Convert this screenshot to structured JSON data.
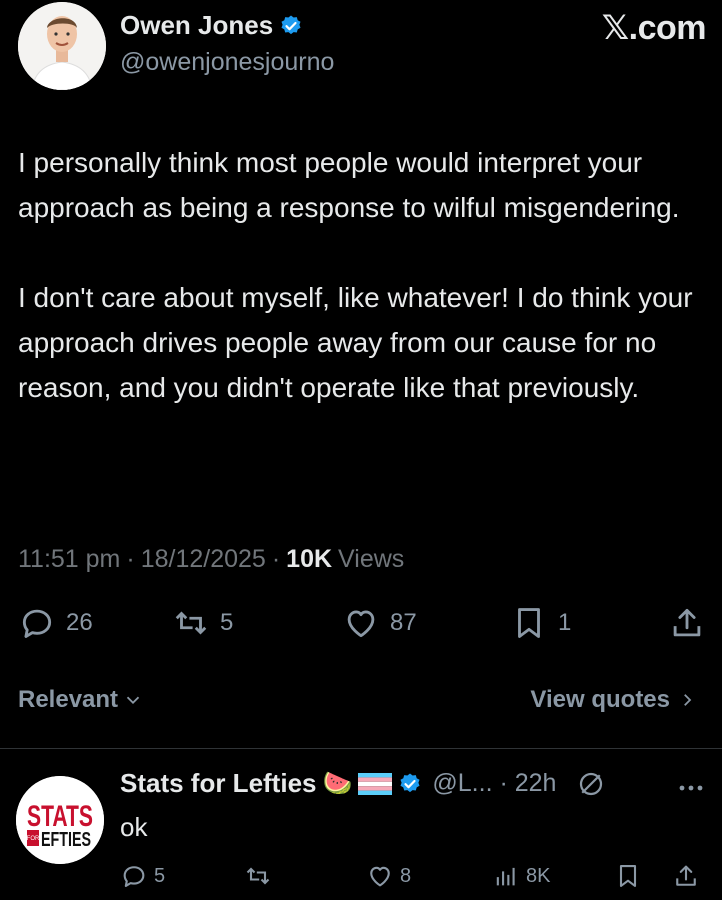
{
  "header": {
    "author_name": "Owen Jones",
    "handle": "@owenjonesjourno",
    "brand": "𝕏.com"
  },
  "tweet": {
    "paragraphs": [
      "I personally think most people would interpret your approach as being a response to wilful misgendering.",
      "I don't care about myself, like whatever! I do think your approach drives people away from our cause for no reason, and you didn't operate like that previously."
    ],
    "time": "11:51 pm",
    "date": "18/12/2025",
    "views_count": "10K",
    "views_label": "Views",
    "separator": "·"
  },
  "actions": {
    "replies": "26",
    "reposts": "5",
    "likes": "87",
    "bookmarks": "1"
  },
  "replies_bar": {
    "sort_label": "Relevant",
    "view_quotes_label": "View quotes"
  },
  "reply": {
    "author_name": "Stats for Lefties",
    "emoji": "🍉",
    "handle_time": "@L... · 22h",
    "text": "ok",
    "avatar_logo_text": "STATS FOR LEFTIES",
    "counts": {
      "replies": "5",
      "likes": "8",
      "views": "8K"
    }
  },
  "colors": {
    "background": "#000000",
    "text": "#e7e9ea",
    "muted": "#71767b",
    "verified": "#1d9bf0",
    "divider": "#2f3336"
  }
}
